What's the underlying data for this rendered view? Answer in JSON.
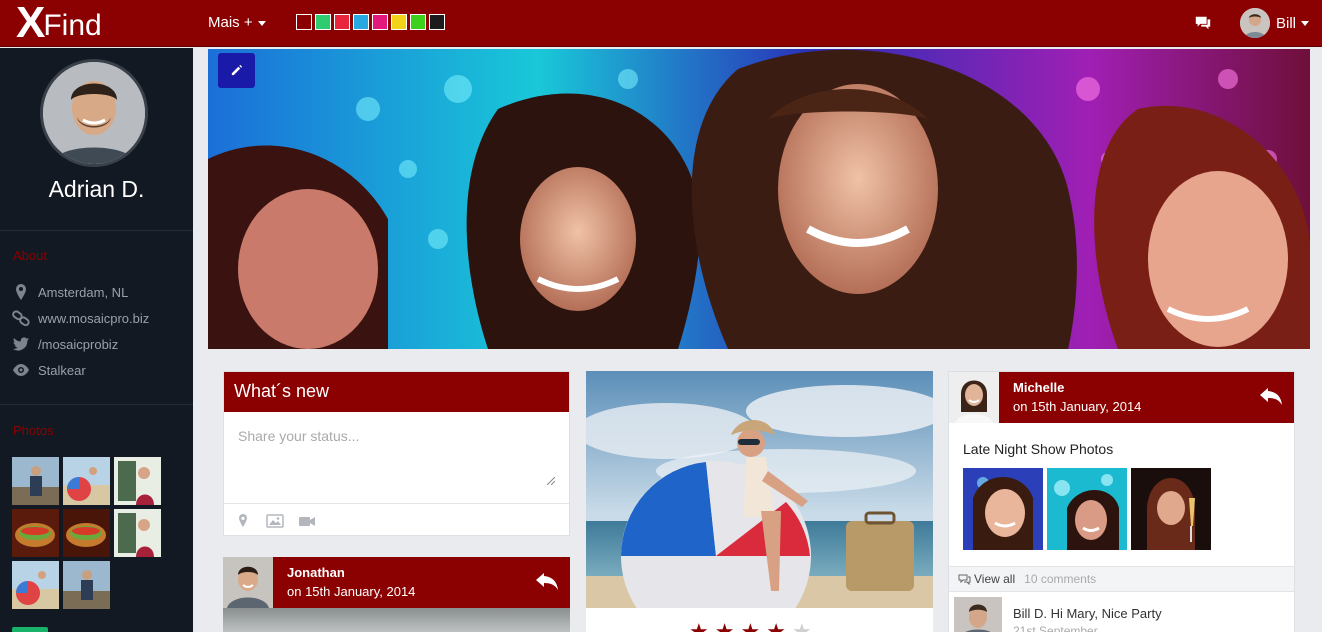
{
  "topbar": {
    "logo_x": "X",
    "logo_rest": "Find",
    "menu_label": "Mais +",
    "swatches": [
      "#8b0000",
      "#2ecc71",
      "#e8253c",
      "#28a8e0",
      "#e2187c",
      "#f2d31a",
      "#3bd11c",
      "#1c1c1c"
    ],
    "user_name": "Bill"
  },
  "sidebar": {
    "profile_name": "Adrian D.",
    "about_heading": "About",
    "about": {
      "location": "Amsterdam, NL",
      "website": "www.mosaicpro.biz",
      "twitter": "/mosaicprobiz",
      "watch": "Stalkear"
    },
    "photos_heading": "Photos"
  },
  "whats_new": {
    "title": "What´s new",
    "placeholder": "Share your status..."
  },
  "post_left": {
    "name": "Jonathan",
    "date": "on 15th January, 2014"
  },
  "post_middle": {
    "rating": 4,
    "rating_max": 5
  },
  "post_right": {
    "name": "Michelle",
    "date": "on 15th January, 2014",
    "title": "Late Night Show Photos",
    "view_all": "View all",
    "comments_count": "10 comments",
    "comment": {
      "author": "Bill D.",
      "text": "Hi Mary, Nice Party",
      "date": "21st September"
    }
  },
  "colors": {
    "brand": "#8b0000",
    "sidebar": "#131922",
    "edit_button": "#1a1aa8"
  }
}
